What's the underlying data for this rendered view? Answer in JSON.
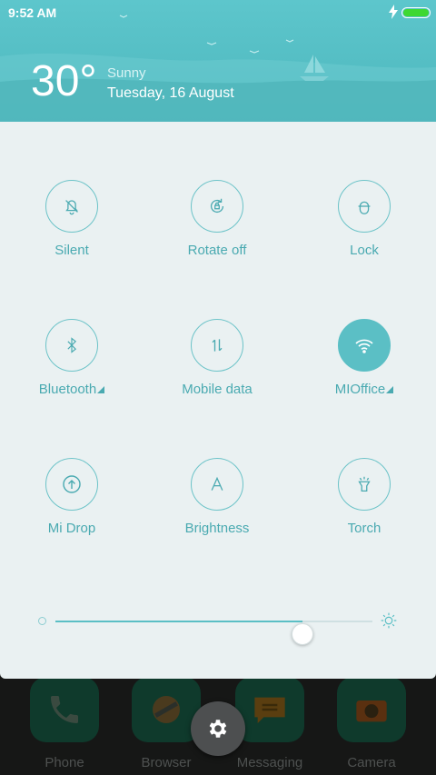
{
  "status_bar": {
    "time": "9:52 AM",
    "charging_icon": "bolt-icon",
    "battery_color": "#3ed832"
  },
  "weather": {
    "temperature": "30°",
    "condition": "Sunny",
    "date": "Tuesday, 16 August"
  },
  "toggles": [
    {
      "label": "Silent",
      "icon": "bell-off-icon",
      "active": false
    },
    {
      "label": "Rotate off",
      "icon": "rotate-lock-icon",
      "active": false
    },
    {
      "label": "Lock",
      "icon": "lock-icon",
      "active": false
    },
    {
      "label": "Bluetooth",
      "icon": "bluetooth-icon",
      "active": false,
      "expandable": true
    },
    {
      "label": "Mobile data",
      "icon": "mobile-data-icon",
      "active": false
    },
    {
      "label": "MIOffice",
      "icon": "wifi-icon",
      "active": true,
      "expandable": true
    },
    {
      "label": "Mi Drop",
      "icon": "mi-drop-icon",
      "active": false
    },
    {
      "label": "Brightness",
      "icon": "brightness-auto-icon",
      "active": false
    },
    {
      "label": "Torch",
      "icon": "torch-icon",
      "active": false
    }
  ],
  "brightness": {
    "level": 0.78
  },
  "dock": {
    "apps": [
      "Phone",
      "Browser",
      "Messaging",
      "Camera"
    ]
  },
  "colors": {
    "accent": "#5bbfc5",
    "header": "#4db7bd",
    "panel": "#eaf1f2"
  }
}
